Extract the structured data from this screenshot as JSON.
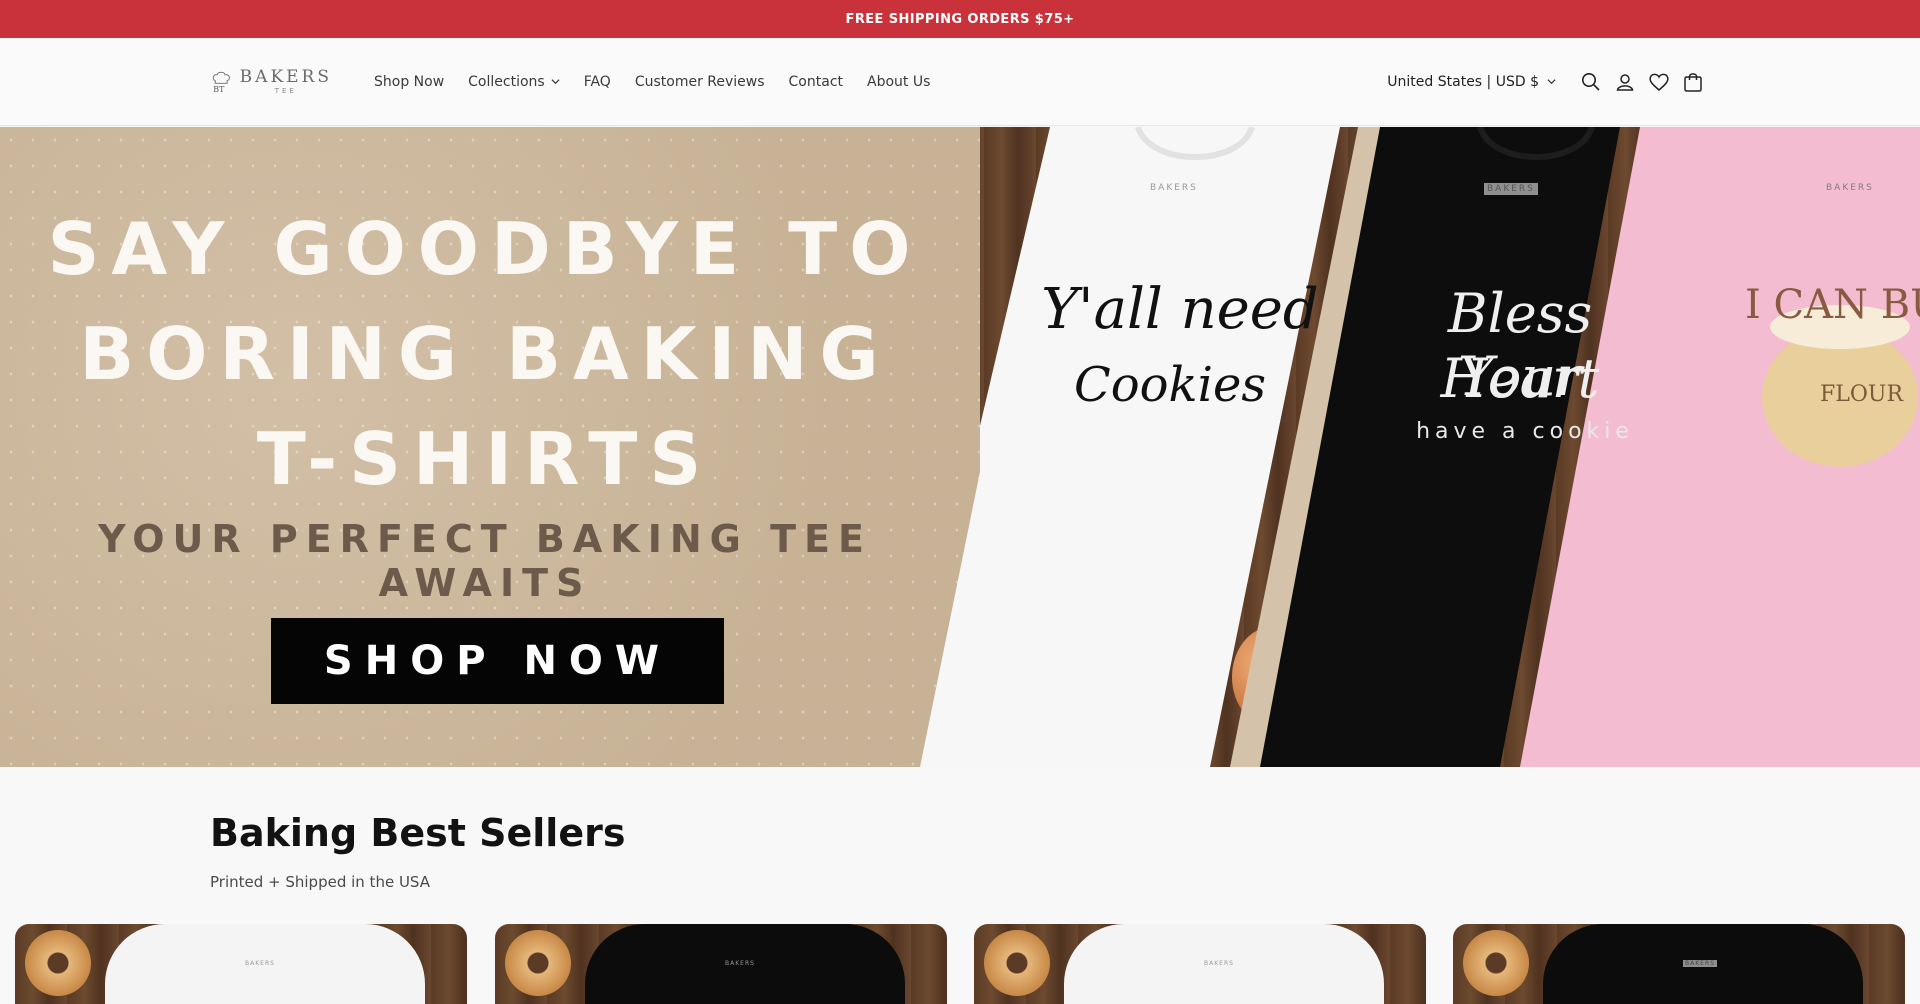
{
  "announcement": {
    "text": "FREE SHIPPING ORDERS $75+"
  },
  "header": {
    "logo": {
      "big": "BAKERS",
      "small": "TEE"
    },
    "nav": [
      {
        "label": "Shop Now",
        "dropdown": false
      },
      {
        "label": "Collections",
        "dropdown": true
      },
      {
        "label": "FAQ",
        "dropdown": false
      },
      {
        "label": "Customer Reviews",
        "dropdown": false
      },
      {
        "label": "Contact",
        "dropdown": false
      },
      {
        "label": "About Us",
        "dropdown": false
      }
    ],
    "country_selector": "United States | USD $",
    "icons": [
      "search-icon",
      "account-icon",
      "wishlist-heart-icon",
      "cart-icon"
    ]
  },
  "hero": {
    "headline_lines": [
      "SAY GOODBYE TO",
      "BORING BAKING",
      "T-SHIRTS"
    ],
    "subheadline": "YOUR PERFECT BAKING TEE AWAITS",
    "button_label": "SHOP NOW",
    "shirts": [
      {
        "color": "white",
        "line1": "Y'all need",
        "line2": "Cookies",
        "line3": ""
      },
      {
        "color": "black",
        "line1": "Bless Your",
        "line2": "Heart",
        "line3": "have a cookie"
      },
      {
        "color": "pink",
        "line1": "I CAN BUY MYS",
        "line2": "FLOUR",
        "line3": ""
      }
    ],
    "shirt_logo": "BAKERS"
  },
  "best_sellers": {
    "title": "Baking Best Sellers",
    "subtitle": "Printed + Shipped in the USA",
    "cards": [
      {
        "tee_color": "#f4f4f4",
        "logo": "BAKERS"
      },
      {
        "tee_color": "#0c0c0c",
        "logo": "BAKERS"
      },
      {
        "tee_color": "#f4f4f4",
        "logo": "BAKERS"
      },
      {
        "tee_color": "#0c0c0c",
        "logo": "BAKERS"
      }
    ]
  },
  "colors": {
    "announcement_bg": "#c9323a",
    "hero_bg": "#cbb69c",
    "button_bg": "#050505"
  }
}
